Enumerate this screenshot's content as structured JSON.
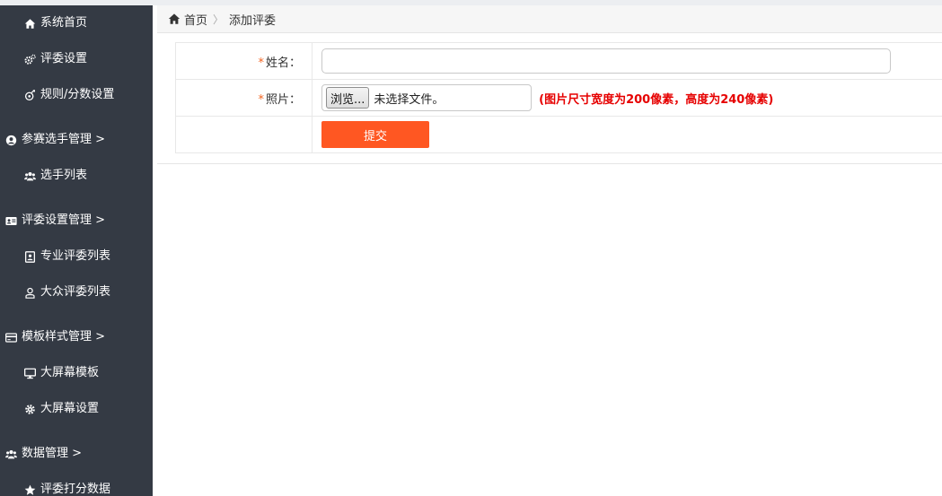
{
  "sidebar": {
    "items": [
      {
        "label": "系统首页",
        "icon": "home-icon",
        "type": "sub"
      },
      {
        "label": "评委设置",
        "icon": "gears-icon",
        "type": "sub"
      },
      {
        "label": "规则/分数设置",
        "icon": "rules-icon",
        "type": "sub"
      },
      {
        "label": "参赛选手管理 >",
        "icon": "user-circle-icon",
        "type": "group"
      },
      {
        "label": "选手列表",
        "icon": "users-icon",
        "type": "sub"
      },
      {
        "label": "评委设置管理 >",
        "icon": "id-card-icon",
        "type": "group"
      },
      {
        "label": "专业评委列表",
        "icon": "portrait-icon",
        "type": "sub"
      },
      {
        "label": "大众评委列表",
        "icon": "user-outline-icon",
        "type": "sub"
      },
      {
        "label": "模板样式管理 >",
        "icon": "credit-card-icon",
        "type": "group"
      },
      {
        "label": "大屏幕模板",
        "icon": "monitor-icon",
        "type": "sub"
      },
      {
        "label": "大屏幕设置",
        "icon": "gear-icon",
        "type": "sub"
      },
      {
        "label": "数据管理 >",
        "icon": "users-icon",
        "type": "group"
      },
      {
        "label": "评委打分数据",
        "icon": "star-icon",
        "type": "sub"
      }
    ]
  },
  "breadcrumb": {
    "home": "首页",
    "separator": "〉",
    "current": "添加评委"
  },
  "form": {
    "required_mark": "*",
    "name_label": "姓名：",
    "name_value": "",
    "photo_label": "照片：",
    "browse_label": "浏览...",
    "file_status": "未选择文件。",
    "photo_hint": "(图片尺寸宽度为200像素，高度为240像素)",
    "submit_label": "提交"
  },
  "colors": {
    "sidebar_bg": "#343a44",
    "accent": "#ff5722",
    "required": "#f26522",
    "hint": "#e60000"
  }
}
